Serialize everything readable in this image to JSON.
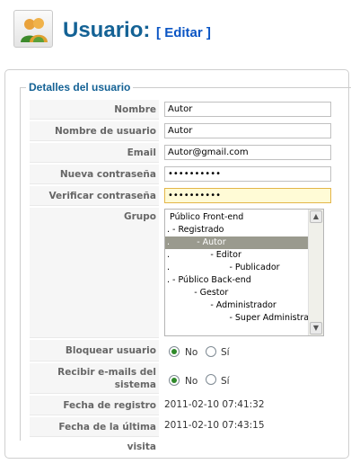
{
  "header": {
    "title": "Usuario:",
    "edit_label": "[ Editar ]",
    "icon": "users-icon"
  },
  "legend": "Detalles del usuario",
  "fields": {
    "name": {
      "label": "Nombre",
      "value": "Autor"
    },
    "username": {
      "label": "Nombre de usuario",
      "value": "Autor"
    },
    "email": {
      "label": "Email",
      "value": "Autor@gmail.com"
    },
    "new_password": {
      "label": "Nueva contraseña",
      "value": "••••••••••"
    },
    "verify_password": {
      "label": "Verificar contraseña",
      "value": "••••••••••"
    }
  },
  "group": {
    "label": "Grupo",
    "options": [
      " Público Front-end",
      ". - Registrado",
      ".          - Autor",
      ".               - Editor",
      ".                      - Publicador",
      ". - Público Back-end",
      "          - Gestor",
      "                - Administrador",
      "                       - Super Administrador"
    ],
    "selected_index": 2
  },
  "block_user": {
    "label": "Bloquear usuario",
    "options": [
      "No",
      "Sí"
    ],
    "selected": "No"
  },
  "receive_emails": {
    "label_line1": "Recibir e-mails del",
    "label_line2": "sistema",
    "options": [
      "No",
      "Sí"
    ],
    "selected": "No"
  },
  "register_date": {
    "label": "Fecha de registro",
    "value": "2011-02-10 07:41:32"
  },
  "last_visit": {
    "label": "Fecha de la última visita",
    "value": "2011-02-10 07:43:15"
  }
}
